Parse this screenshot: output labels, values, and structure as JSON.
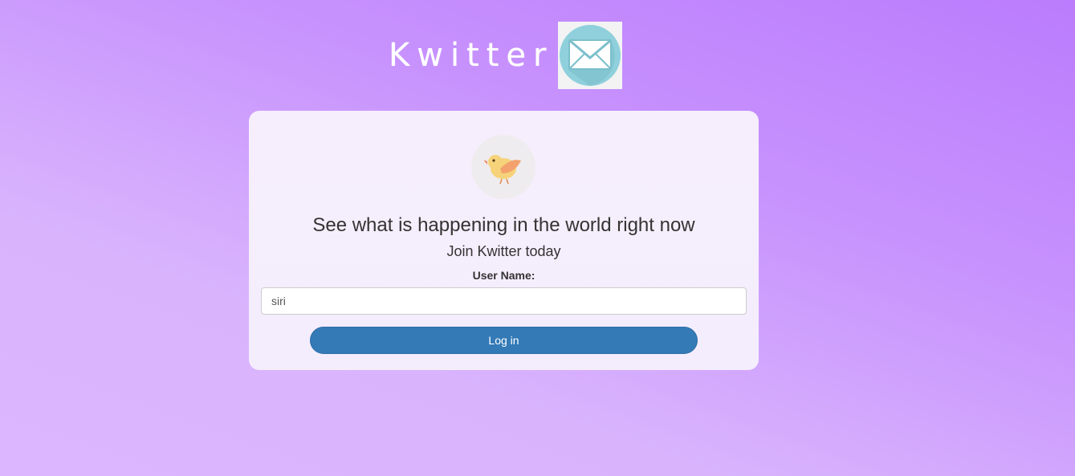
{
  "header": {
    "brand": "Kwitter",
    "logo_icon": "envelope-icon"
  },
  "card": {
    "bird_icon": "bird-icon",
    "headline": "See what is happening in the world right now",
    "subline": "Join Kwitter today",
    "username_label": "User Name:",
    "username_value": "siri",
    "login_label": "Log in"
  },
  "colors": {
    "background_top": "#bb7cfd",
    "background_bottom": "#dcb6fe",
    "card_background": "#f5eefc",
    "button": "#337ab7",
    "text": "#333333"
  }
}
